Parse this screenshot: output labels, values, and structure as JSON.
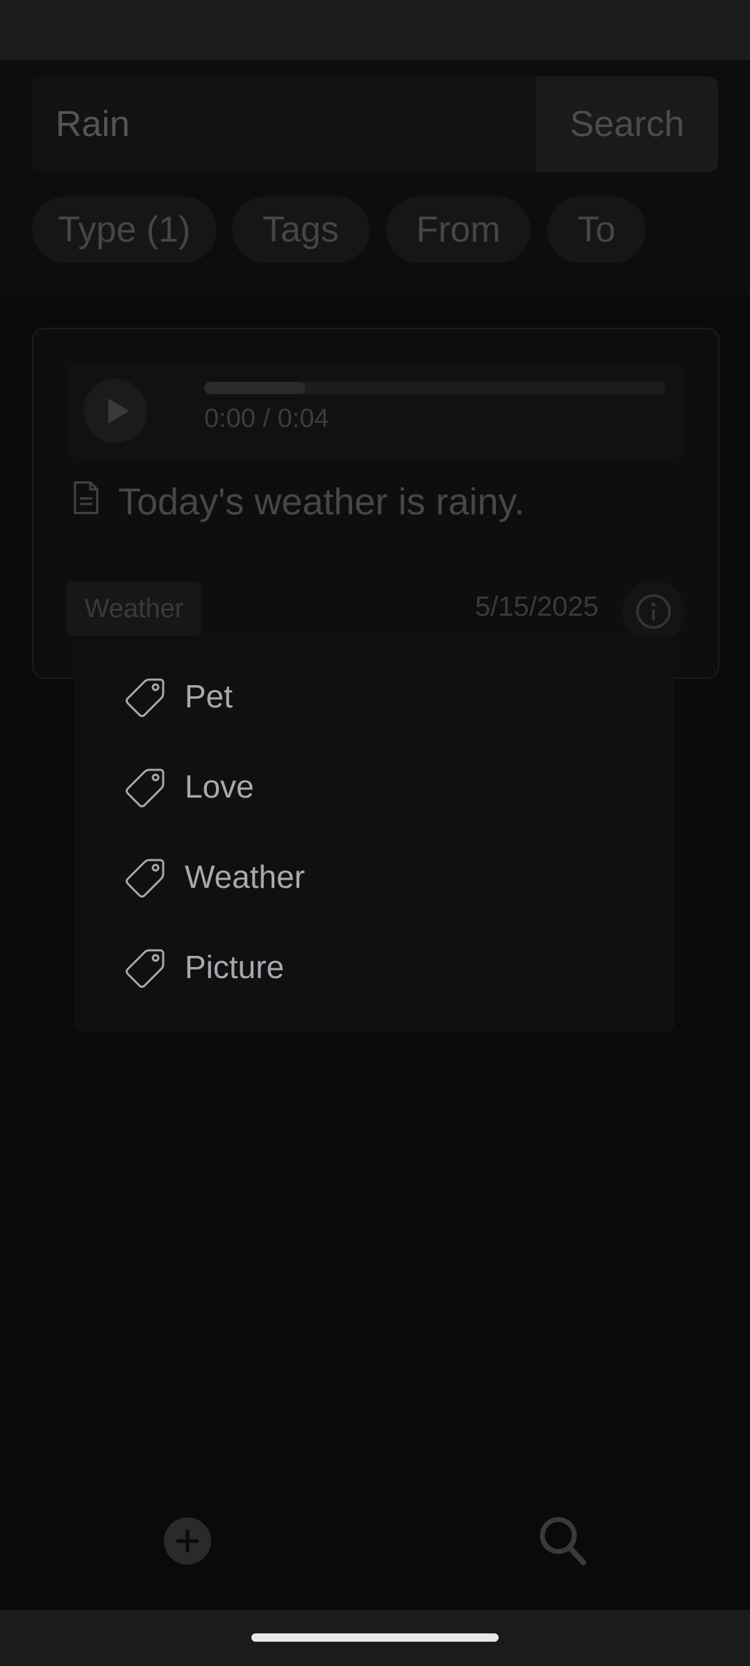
{
  "search": {
    "value": "Rain",
    "button_label": "Search"
  },
  "filters": {
    "type_label": "Type (1)",
    "tags_label": "Tags",
    "from_label": "From",
    "to_label": "To"
  },
  "card": {
    "audio": {
      "time": "0:00 / 0:04",
      "progress_fraction": 0.22
    },
    "transcript": "Today's weather is rainy.",
    "tag": "Weather",
    "date": "5/15/2025"
  },
  "tag_menu": {
    "items": [
      {
        "label": "Pet",
        "icon": "tag-icon"
      },
      {
        "label": "Love",
        "icon": "tag-icon"
      },
      {
        "label": "Weather",
        "icon": "tag-icon"
      },
      {
        "label": "Picture",
        "icon": "tag-icon"
      }
    ]
  },
  "bottom_nav": {
    "add_icon": "plus-circle-icon",
    "search_icon": "search-icon"
  },
  "colors": {
    "background": "#0a0a0a",
    "menu_text": "#a8a9b0",
    "home_indicator": "#e8e8e8"
  }
}
